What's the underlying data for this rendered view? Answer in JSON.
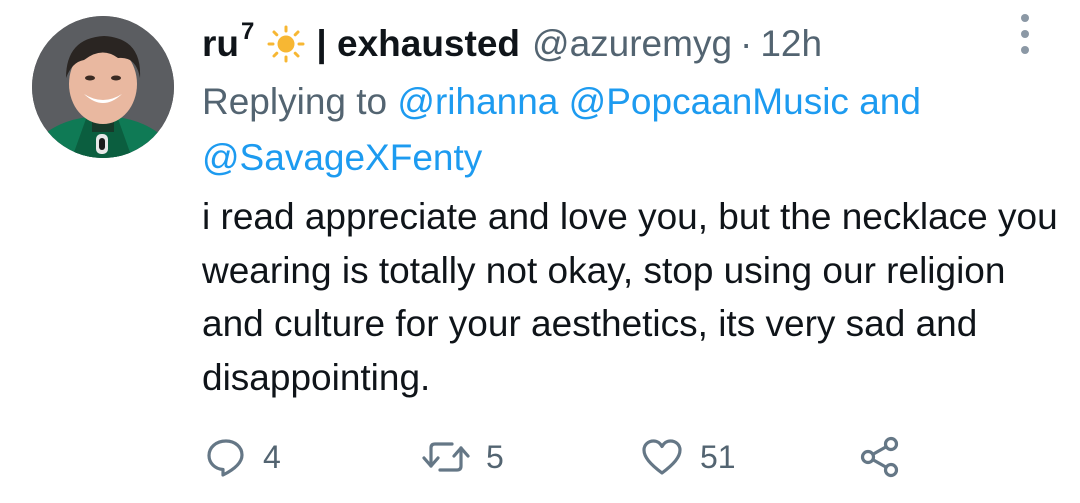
{
  "tweet": {
    "display_name": "ru",
    "name_superscript": "7",
    "name_suffix": "| exhausted",
    "handle": "@azuremyg",
    "separator": "·",
    "timestamp": "12h",
    "reply_prefix": "Replying to",
    "mentions": [
      "@rihanna",
      "@PopcaanMusic",
      "@SavageXFenty"
    ],
    "mention_joiner": "and",
    "body": "i read appreciate and love you, but the necklace you wearing is totally not okay, stop using our religion and culture for your aesthetics, its very sad and disappointing.",
    "avatar_icon": "profile-photo",
    "more_icon": "vertical-ellipsis-icon"
  },
  "actions": {
    "reply": {
      "icon": "reply-bubble-icon",
      "count": "4"
    },
    "retweet": {
      "icon": "retweet-icon",
      "count": "5"
    },
    "like": {
      "icon": "heart-icon",
      "count": "51"
    },
    "share": {
      "icon": "share-icon"
    }
  },
  "colors": {
    "text_primary": "#0f1419",
    "text_secondary": "#536471",
    "link": "#1d9bf0",
    "icon": "#657786",
    "sun_emoji": "#f7b733"
  }
}
